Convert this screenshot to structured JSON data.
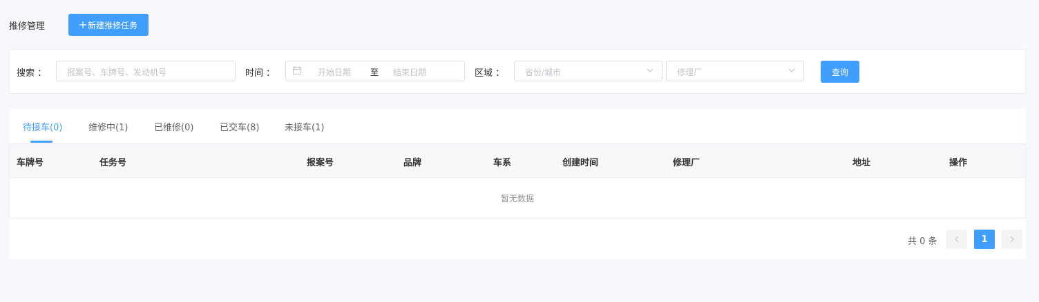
{
  "header": {
    "title": "推修管理",
    "new_button": "新建推修任务"
  },
  "filters": {
    "search_label": "搜索 ：",
    "search_placeholder": "报案号、车牌号、发动机号",
    "time_label": "时间 ：",
    "start_placeholder": "开始日期",
    "range_separator": "至",
    "end_placeholder": "结束日期",
    "region_label": "区域 ：",
    "province_placeholder": "省份/城市",
    "factory_placeholder": "修理厂",
    "query_button": "查询"
  },
  "tabs": [
    {
      "label": "待接车(0)",
      "active": true
    },
    {
      "label": "维修中(1)",
      "active": false
    },
    {
      "label": "已维修(0)",
      "active": false
    },
    {
      "label": "已交车(8)",
      "active": false
    },
    {
      "label": "未接车(1)",
      "active": false
    }
  ],
  "table": {
    "columns": [
      "车牌号",
      "任务号",
      "报案号",
      "品牌",
      "车系",
      "创建时间",
      "修理厂",
      "地址",
      "操作"
    ],
    "rows": [],
    "empty_text": "暂无数据"
  },
  "pagination": {
    "total_text": "共 0 条",
    "current_page": "1"
  },
  "colors": {
    "primary": "#409eff",
    "background": "#f7f8fb"
  }
}
